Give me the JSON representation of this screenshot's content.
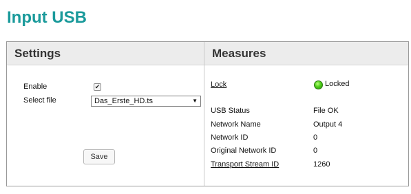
{
  "page": {
    "title": "Input USB"
  },
  "settings": {
    "header": "Settings",
    "enable_label": "Enable",
    "enable_checked": true,
    "select_file_label": "Select file",
    "select_file_value": "Das_Erste_HD.ts",
    "save_label": "Save"
  },
  "measures": {
    "header": "Measures",
    "lock_label": "Lock",
    "lock_value": "Locked",
    "lock_status_color": "#4fcf1a",
    "rows": [
      {
        "label": "USB Status",
        "value": "File OK"
      },
      {
        "label": "Network Name",
        "value": "Output 4"
      },
      {
        "label": "Network ID",
        "value": "0"
      },
      {
        "label": "Original Network ID",
        "value": "0"
      },
      {
        "label": "Transport Stream ID",
        "value": "1260"
      }
    ]
  }
}
